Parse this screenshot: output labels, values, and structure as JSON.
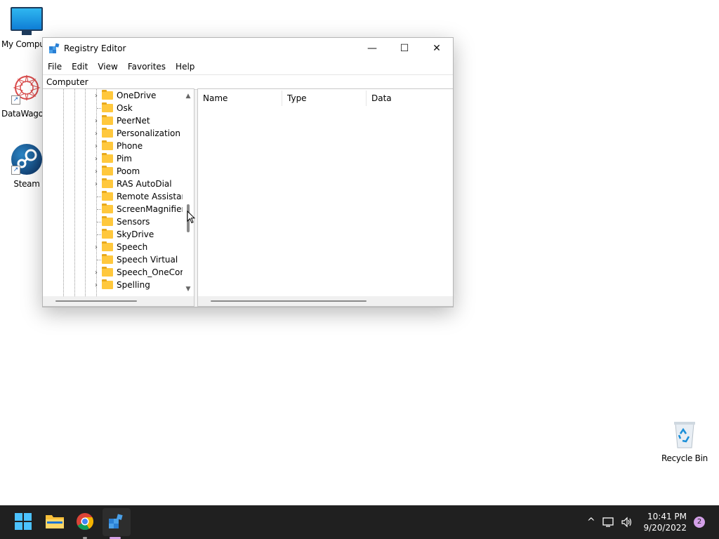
{
  "desktop": {
    "icons": [
      {
        "label": "My Compu"
      },
      {
        "label": "DataWago"
      },
      {
        "label": "Steam"
      },
      {
        "label": "Recycle Bin"
      }
    ]
  },
  "window": {
    "title": "Registry Editor",
    "controls": {
      "minimize": "—",
      "maximize": "☐",
      "close": "✕"
    },
    "menu": [
      "File",
      "Edit",
      "View",
      "Favorites",
      "Help"
    ],
    "address": "Computer",
    "tree": [
      {
        "name": "OneDrive",
        "expandable": true
      },
      {
        "name": "Osk",
        "expandable": false
      },
      {
        "name": "PeerNet",
        "expandable": true
      },
      {
        "name": "Personalization",
        "expandable": true
      },
      {
        "name": "Phone",
        "expandable": true
      },
      {
        "name": "Pim",
        "expandable": true
      },
      {
        "name": "Poom",
        "expandable": true
      },
      {
        "name": "RAS AutoDial",
        "expandable": true
      },
      {
        "name": "Remote Assistanc",
        "expandable": false
      },
      {
        "name": "ScreenMagnifier",
        "expandable": false
      },
      {
        "name": "Sensors",
        "expandable": false
      },
      {
        "name": "SkyDrive",
        "expandable": false
      },
      {
        "name": "Speech",
        "expandable": true
      },
      {
        "name": "Speech Virtual",
        "expandable": false
      },
      {
        "name": "Speech_OneCore",
        "expandable": true
      },
      {
        "name": "Spelling",
        "expandable": true
      }
    ],
    "columns": [
      "Name",
      "Type",
      "Data"
    ],
    "scroll_arrows": {
      "up": "▲",
      "down": "▼",
      "expand": "›"
    }
  },
  "taskbar": {
    "time": "10:41 PM",
    "date": "9/20/2022",
    "notifications": "2",
    "tray_chevron": "^",
    "accent": "#202020"
  }
}
